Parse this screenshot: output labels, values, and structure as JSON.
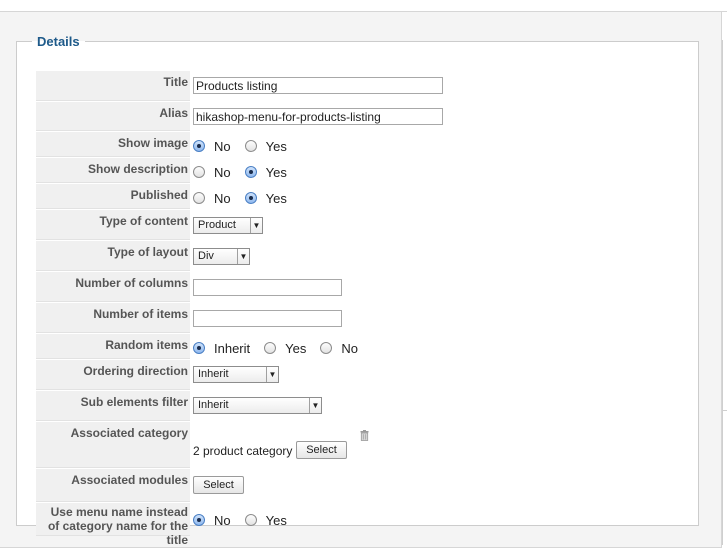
{
  "details": {
    "legend": "Details",
    "fields": {
      "title": {
        "label": "Title",
        "value": "Products listing"
      },
      "alias": {
        "label": "Alias",
        "value": "hikashop-menu-for-products-listing"
      },
      "show_image": {
        "label": "Show image",
        "options": [
          "No",
          "Yes"
        ],
        "selected": "No"
      },
      "show_description": {
        "label": "Show description",
        "options": [
          "No",
          "Yes"
        ],
        "selected": "Yes"
      },
      "published": {
        "label": "Published",
        "options": [
          "No",
          "Yes"
        ],
        "selected": "Yes"
      },
      "type_of_content": {
        "label": "Type of content",
        "value": "Product"
      },
      "type_of_layout": {
        "label": "Type of layout",
        "value": "Div"
      },
      "number_of_columns": {
        "label": "Number of columns",
        "value": ""
      },
      "number_of_items": {
        "label": "Number of items",
        "value": ""
      },
      "random_items": {
        "label": "Random items",
        "options": [
          "Inherit",
          "Yes",
          "No"
        ],
        "selected": "Inherit"
      },
      "ordering_direction": {
        "label": "Ordering direction",
        "value": "Inherit"
      },
      "sub_elements_filter": {
        "label": "Sub elements filter",
        "value": "Inherit"
      },
      "associated_category": {
        "label": "Associated category",
        "value_text": "2 product category",
        "button": "Select",
        "delete_icon": "trash-icon"
      },
      "associated_modules": {
        "label": "Associated modules",
        "button": "Select"
      },
      "use_menu_name": {
        "label": "Use menu name instead of category name for the title",
        "options": [
          "No",
          "Yes"
        ],
        "selected": "No"
      }
    }
  },
  "colors": {
    "legend": "#1e5a8a",
    "label_bg": "#f0f0f0",
    "radio_checked": "#4a7fc4"
  }
}
